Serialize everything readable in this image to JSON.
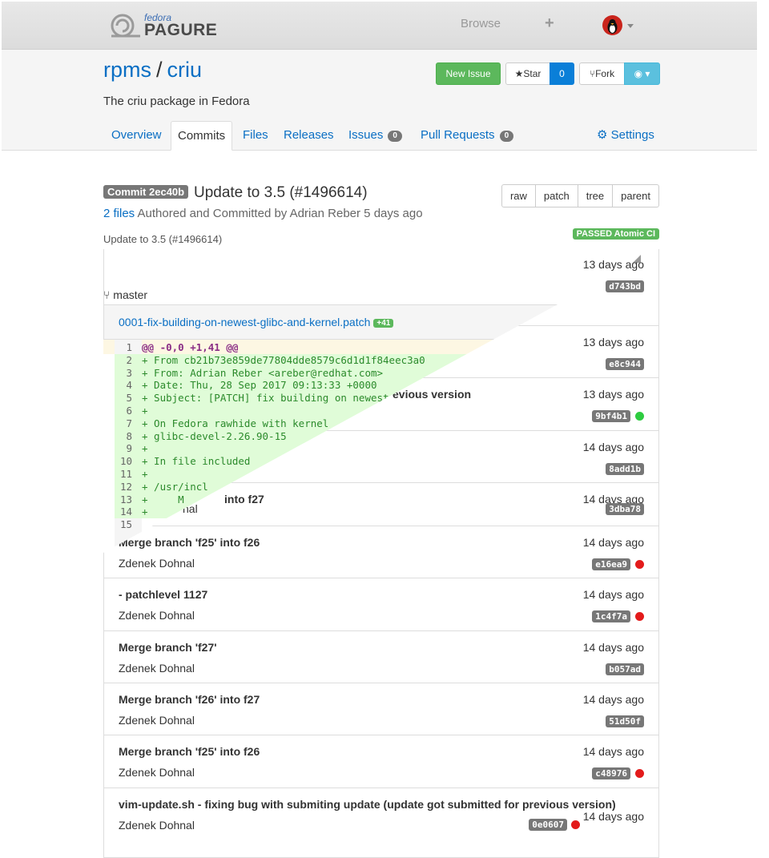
{
  "topbar": {
    "logo_small": "fedora",
    "logo_large": "PAGURE",
    "browse": "Browse",
    "plus": "+"
  },
  "repo": {
    "namespace": "rpms",
    "separator": "/",
    "name": "criu",
    "description": "The criu package in Fedora",
    "buttons": {
      "new_issue": "New Issue",
      "star": "★Star",
      "star_count": "0",
      "fork": "Fork",
      "watch": "◉ ▾"
    }
  },
  "tabs": [
    {
      "label": "Overview"
    },
    {
      "label": "Commits"
    },
    {
      "label": "Files"
    },
    {
      "label": "Releases"
    },
    {
      "label": "Issues",
      "count": "0"
    },
    {
      "label": "Pull Requests",
      "count": "0"
    },
    {
      "label": "Settings",
      "icon": "gear-icon"
    }
  ],
  "commit": {
    "badge": "Commit 2ec40b",
    "subject": "Update to 3.5 (#1496614)",
    "files_link": "2 files",
    "meta": " Authored and Committed by Adrian Reber 5 days ago",
    "message": "Update to 3.5 (#1496614)",
    "buttons": [
      "raw",
      "patch",
      "tree",
      "parent"
    ],
    "ci": "PASSED Atomic CI"
  },
  "branch": "master",
  "diff": {
    "file": "0001-fix-building-on-newest-glibc-and-kernel.patch",
    "added": "+41",
    "lines": [
      {
        "n": "1",
        "t": "@@ -0,0 +1,41 @@",
        "k": "hunk"
      },
      {
        "n": "2",
        "t": "+ From cb21b73e859de77804dde8579c6d1d1f84eec3a0",
        "k": "add"
      },
      {
        "n": "3",
        "t": "+ From: Adrian Reber <areber@redhat.com>",
        "k": "add"
      },
      {
        "n": "4",
        "t": "+ Date: Thu, 28 Sep 2017 09:13:33 +0000",
        "k": "add"
      },
      {
        "n": "5",
        "t": "+ Subject: [PATCH] fix building on newest",
        "k": "add"
      },
      {
        "n": "6",
        "t": "+",
        "k": "add"
      },
      {
        "n": "7",
        "t": "+ On Fedora rawhide with kernel",
        "k": "add"
      },
      {
        "n": "8",
        "t": "+ glibc-devel-2.26.90-15",
        "k": "add"
      },
      {
        "n": "9",
        "t": "+",
        "k": "add"
      },
      {
        "n": "10",
        "t": "+ In file included",
        "k": "add"
      },
      {
        "n": "11",
        "t": "+",
        "k": "add"
      },
      {
        "n": "12",
        "t": "+ /usr/incl",
        "k": "add"
      },
      {
        "n": "13",
        "t": "+     M",
        "k": "add"
      },
      {
        "n": "14",
        "t": "+",
        "k": "add"
      },
      {
        "n": "15",
        "t": "",
        "k": "ctx"
      }
    ]
  },
  "commits": [
    {
      "subject": "",
      "author": "",
      "when": "13 days ago",
      "hash": "d743bd",
      "status": ""
    },
    {
      "subject": "",
      "author": "",
      "when": "13 days ago",
      "hash": "e8c944",
      "status": ""
    },
    {
      "subject": "evious version",
      "author": "",
      "when": "13 days ago",
      "hash": "9bf4b1",
      "status": "#2ecc40"
    },
    {
      "subject": "",
      "author": "",
      "when": "14 days ago",
      "hash": "8add1b",
      "status": ""
    },
    {
      "subject": "into f27",
      "author": "nal",
      "when": "14 days ago",
      "hash": "3dba78",
      "status": ""
    },
    {
      "subject": "Merge branch 'f25' into f26",
      "author": "Zdenek Dohnal",
      "when": "14 days ago",
      "hash": "e16ea9",
      "status": "#e31b1b"
    },
    {
      "subject": "- patchlevel 1127",
      "author": "Zdenek Dohnal",
      "when": "14 days ago",
      "hash": "1c4f7a",
      "status": "#e31b1b"
    },
    {
      "subject": "Merge branch 'f27'",
      "author": "Zdenek Dohnal",
      "when": "14 days ago",
      "hash": "b057ad",
      "status": ""
    },
    {
      "subject": "Merge branch 'f26' into f27",
      "author": "Zdenek Dohnal",
      "when": "14 days ago",
      "hash": "51d50f",
      "status": ""
    },
    {
      "subject": "Merge branch 'f25' into f26",
      "author": "Zdenek Dohnal",
      "when": "14 days ago",
      "hash": "c48976",
      "status": "#e31b1b"
    },
    {
      "subject": "vim-update.sh - fixing bug with submiting update (update got submitted for previous version)",
      "author": "Zdenek Dohnal",
      "when": "14 days ago",
      "hash": "0e0607",
      "status": "#e31b1b"
    }
  ]
}
